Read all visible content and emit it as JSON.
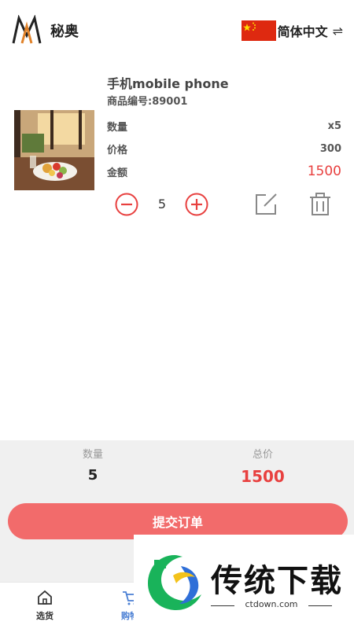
{
  "header": {
    "brand": "秘奥",
    "language_label": "简体中文",
    "swap_icon": "⇌"
  },
  "item": {
    "name": "手机mobile phone",
    "code": "商品编号:89001",
    "quantity_label": "数量",
    "quantity_value": "x5",
    "price_label": "价格",
    "price_value": "300",
    "amount_label": "金额",
    "amount_value": "1500",
    "stepper_value": "5"
  },
  "summary": {
    "quantity_label": "数量",
    "quantity_value": "5",
    "total_label": "总价",
    "total_value": "1500",
    "submit_label": "提交订单"
  },
  "tabs": [
    {
      "label": "选货",
      "icon": "home-icon"
    },
    {
      "label": "购物",
      "icon": "cart-icon"
    }
  ],
  "watermark": {
    "text": "传统下载",
    "url": "ctdown.com"
  },
  "colors": {
    "accent_red": "#e8403f",
    "submit_bg": "#f26b6b",
    "active_tab": "#4a7fd4"
  }
}
